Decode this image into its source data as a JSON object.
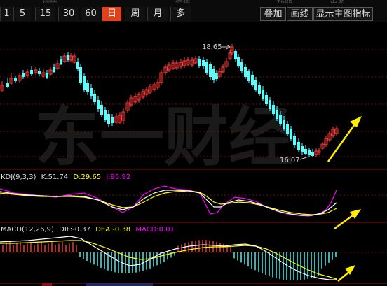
{
  "toolbar": {
    "periods": [
      {
        "label": "1",
        "active": false
      },
      {
        "label": "5",
        "active": false
      },
      {
        "label": "15",
        "active": false
      },
      {
        "label": "30",
        "active": false
      },
      {
        "label": "60",
        "active": false
      },
      {
        "label": "日",
        "active": true
      },
      {
        "label": "周",
        "active": false
      },
      {
        "label": "月",
        "active": false
      },
      {
        "label": "多",
        "active": false
      }
    ],
    "overlay_label": "叠加",
    "draw_label": "画线",
    "show_main_indicator_label": "显示主图指标",
    "top_partial": [
      "行情",
      "资讯",
      "功能",
      "更多"
    ]
  },
  "price_panel": {
    "high_label": "18.65",
    "low_label": "16.07",
    "up_color": "#ff3c3c",
    "down_color": "#54ffff"
  },
  "watermark": "东一财经",
  "kdj_panel": {
    "name": "KDJ(9,3,3)",
    "k_text": "K:51.74",
    "d_text": "D:29.65",
    "j_text": "J:95.92",
    "k_color": "#ffffff",
    "d_color": "#ffff00",
    "j_color": "#ff00ff"
  },
  "macd_panel": {
    "name": "MACD(12,26,9)",
    "dif_text": "DIF:-0.37",
    "dea_text": "DEA:-0.38",
    "macd_text": "MACD:0.01",
    "dif_color": "#ffffff",
    "dea_color": "#ffff00",
    "macd_color": "#ff00ff"
  },
  "annotation_color": "#ffee00"
}
